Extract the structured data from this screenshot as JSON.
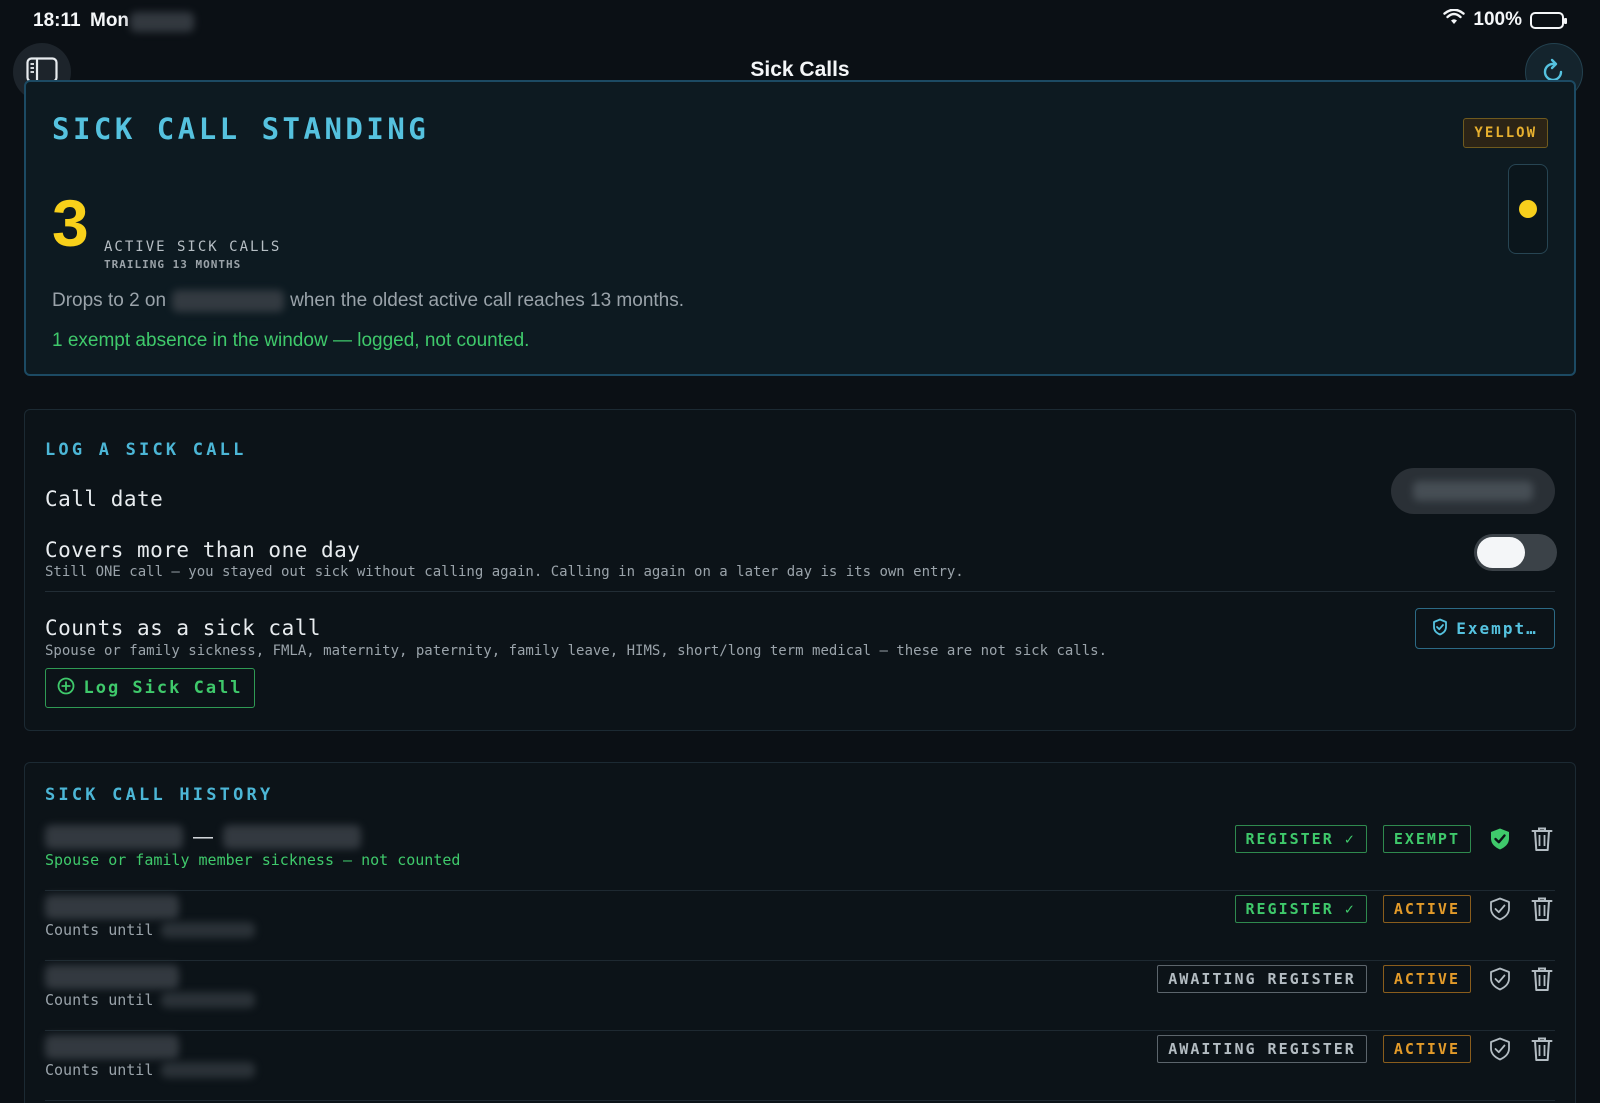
{
  "status_bar": {
    "time": "18:11",
    "day": "Mon",
    "battery": "100%"
  },
  "nav": {
    "title": "Sick Calls"
  },
  "standing": {
    "title": "SICK CALL STANDING",
    "badge": "YELLOW",
    "count": "3",
    "count_label": "ACTIVE SICK CALLS",
    "count_sub": "TRAILING 13 MONTHS",
    "drops_prefix": "Drops to 2 on",
    "drops_suffix": "when the oldest active call reaches 13 months.",
    "exempt_note": "1 exempt absence in the window — logged, not counted.",
    "colors": {
      "accent": "#55c2df",
      "yellow": "#f8d01a",
      "green": "#3fc96b"
    }
  },
  "log": {
    "section_title": "LOG A SICK CALL",
    "call_date_label": "Call date",
    "covers_label": "Covers more than one day",
    "covers_sub": "Still ONE call — you stayed out sick without calling again. Calling in again on a later day is its own entry.",
    "covers_toggle_on": false,
    "counts_label": "Counts as a sick call",
    "counts_sub": "Spouse or family sickness, FMLA, maternity, paternity, family leave, HIMS, short/long term medical — these are not sick calls.",
    "exempt_button": "Exempt…",
    "log_button": "Log Sick Call"
  },
  "history": {
    "section_title": "SICK CALL HISTORY",
    "rows": [
      {
        "sub": "Spouse or family member sickness — not counted",
        "register": "REGISTER ✓",
        "status": "EXEMPT"
      },
      {
        "sub": "Counts until",
        "register": "REGISTER ✓",
        "status": "ACTIVE"
      },
      {
        "sub": "Counts until",
        "register": "AWAITING REGISTER",
        "status": "ACTIVE"
      },
      {
        "sub": "Counts until",
        "register": "AWAITING REGISTER",
        "status": "ACTIVE"
      }
    ]
  }
}
